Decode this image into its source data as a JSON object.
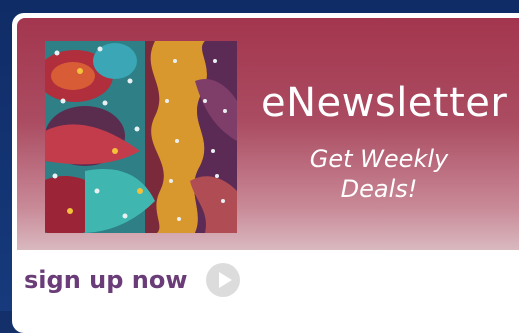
{
  "banner": {
    "title": "eNewsletter",
    "tagline": "Get Weekly Deals!",
    "image": "quilt-art-image"
  },
  "cta": {
    "label": "sign up now",
    "icon": "play-arrow-icon"
  },
  "colors": {
    "page_background": "#13306b",
    "banner_top": "#a3364e",
    "banner_bottom": "#d9b9c0",
    "cta_text": "#6a3c78",
    "icon_circle": "#dcdcdc"
  }
}
